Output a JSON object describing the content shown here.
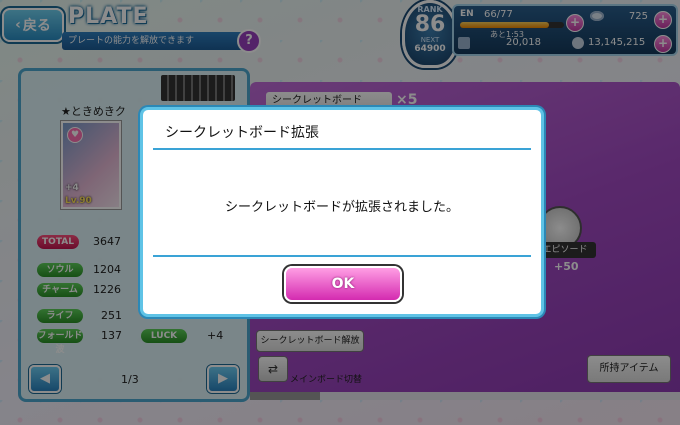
{
  "header": {
    "back_label": "戻る",
    "title": "PLATE",
    "subtitle": "プレートの能力を解放できます",
    "help_label": "?"
  },
  "status": {
    "rank_label": "RANK",
    "rank": "86",
    "next_label": "NEXT",
    "next_value": "64900",
    "en_label": "EN",
    "en_value": "66/77",
    "en_fraction": 0.857,
    "en_timer": "あと1:53",
    "gems": "725",
    "items": "20,018",
    "coins": "13,145,215",
    "plus": "+"
  },
  "plate": {
    "name": "★ときめきク",
    "card_plus": "+4",
    "card_level": "Lv.90",
    "stats": [
      {
        "label": "TOTAL",
        "value": "3647"
      },
      {
        "label": "ソウル",
        "value": "1204"
      },
      {
        "label": "チャーム",
        "value": "1226"
      },
      {
        "label": "ライフ",
        "value": "251"
      },
      {
        "label": "フォールド波",
        "value": "137"
      },
      {
        "label": "LUCK",
        "value": "+4"
      }
    ],
    "page": "1/3",
    "prev": "◀",
    "next": "▶"
  },
  "board": {
    "title": "シークレットボード",
    "count": "×5",
    "episode_label": "エピソード",
    "episode_value": "+50",
    "unlock_label": "シークレットボード解放",
    "swap_label": "メインボード切替",
    "items_label": "所持アイテム"
  },
  "modal": {
    "title": "シークレットボード拡張",
    "message": "シークレットボードが拡張されました。",
    "ok_label": "OK"
  },
  "colors": {
    "accent": "#5fc3e6",
    "ok_button": "#d42bb0",
    "board_bg": "#a34ac4"
  }
}
